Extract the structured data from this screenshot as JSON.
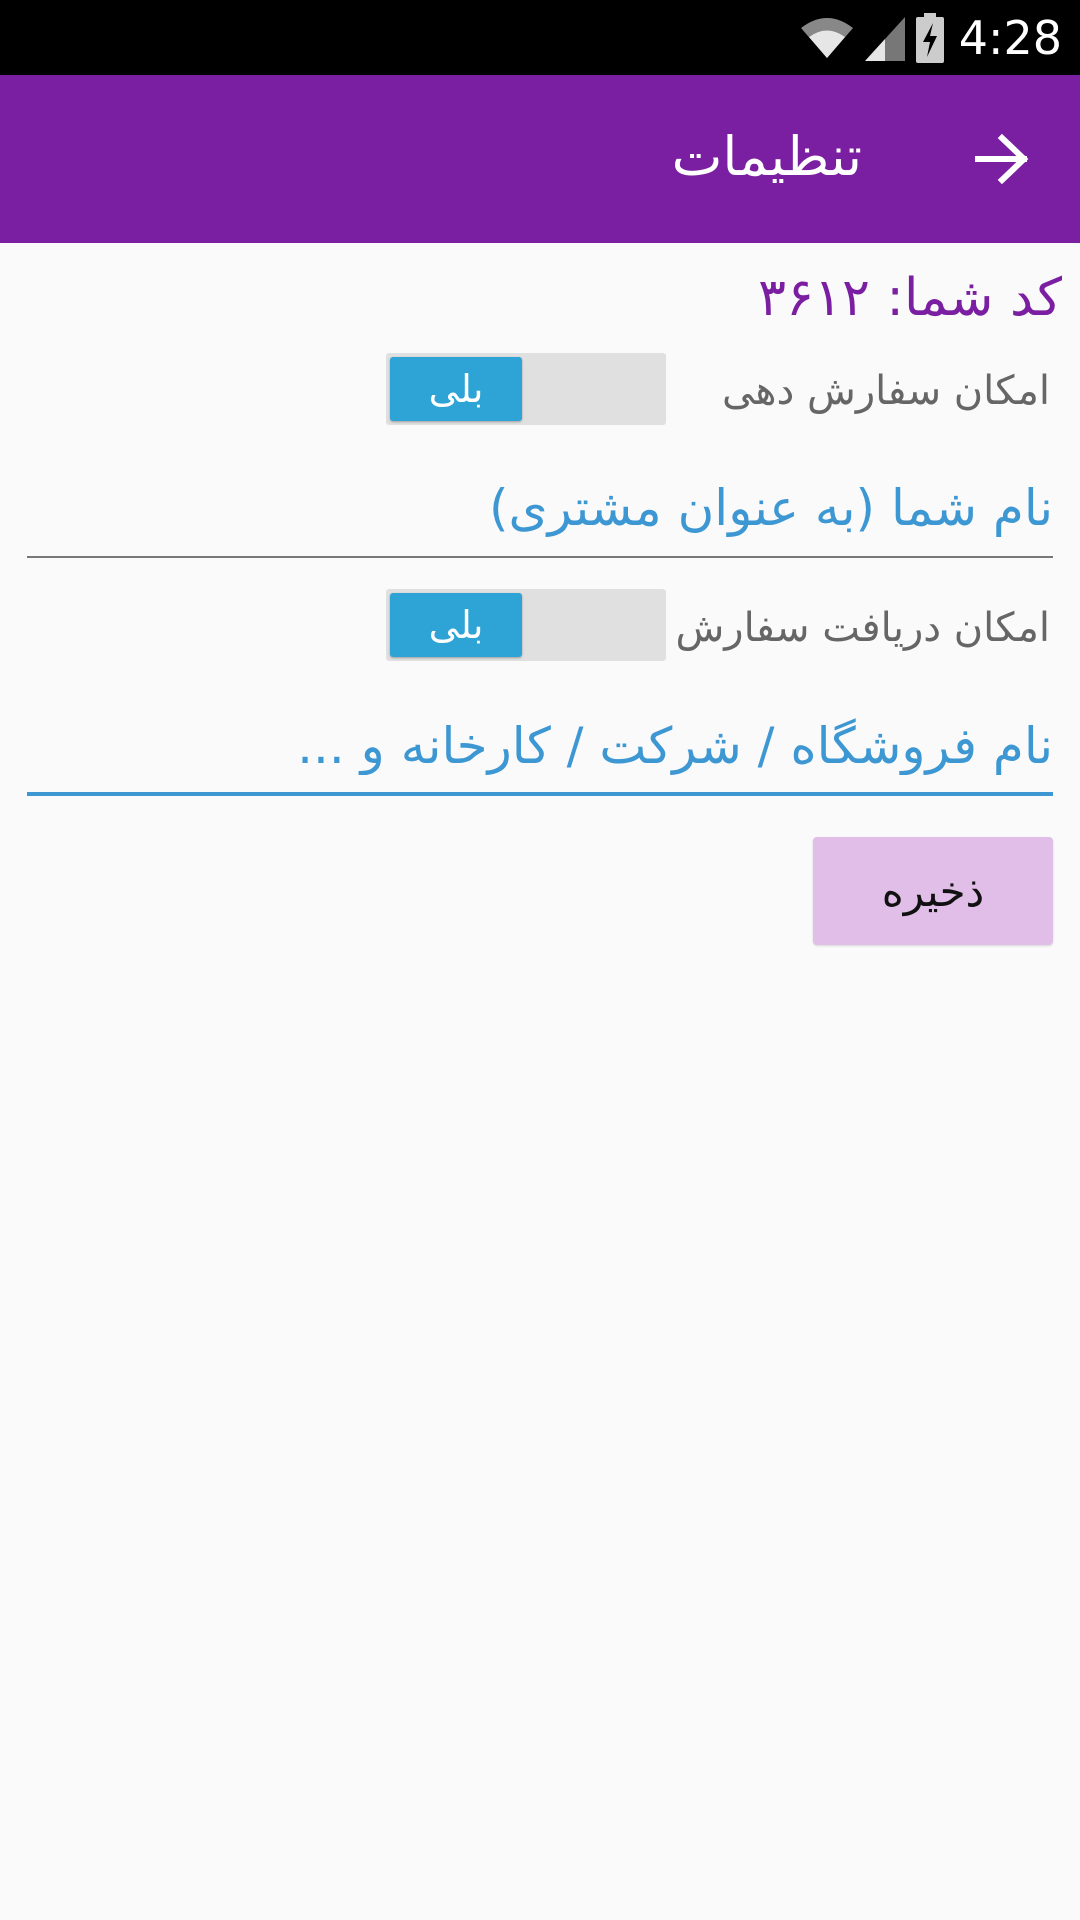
{
  "status_bar": {
    "time": "4:28",
    "icons": [
      "wifi-icon",
      "cell-signal-icon",
      "battery-charging-icon"
    ]
  },
  "app_bar": {
    "title": "تنظیمات",
    "back_icon": "arrow-right-icon",
    "color": "#7b1fa2"
  },
  "main": {
    "code_text": "کد شما: ۳۶۱۲",
    "ordering_toggle": {
      "label": "امکان سفارش دهی",
      "value": "بلی"
    },
    "name_field": {
      "placeholder": "نام شما (به عنوان مشتری)"
    },
    "receiving_toggle": {
      "label": "امکان دریافت سفارش",
      "value": "بلی"
    },
    "store_field": {
      "placeholder": "نام فروشگاه / شرکت / کارخانه و ..."
    },
    "save_label": "ذخیره"
  },
  "colors": {
    "accent": "#3c97d3",
    "toggle_on": "#2ea4d6",
    "button_bg": "#e1bee7"
  }
}
